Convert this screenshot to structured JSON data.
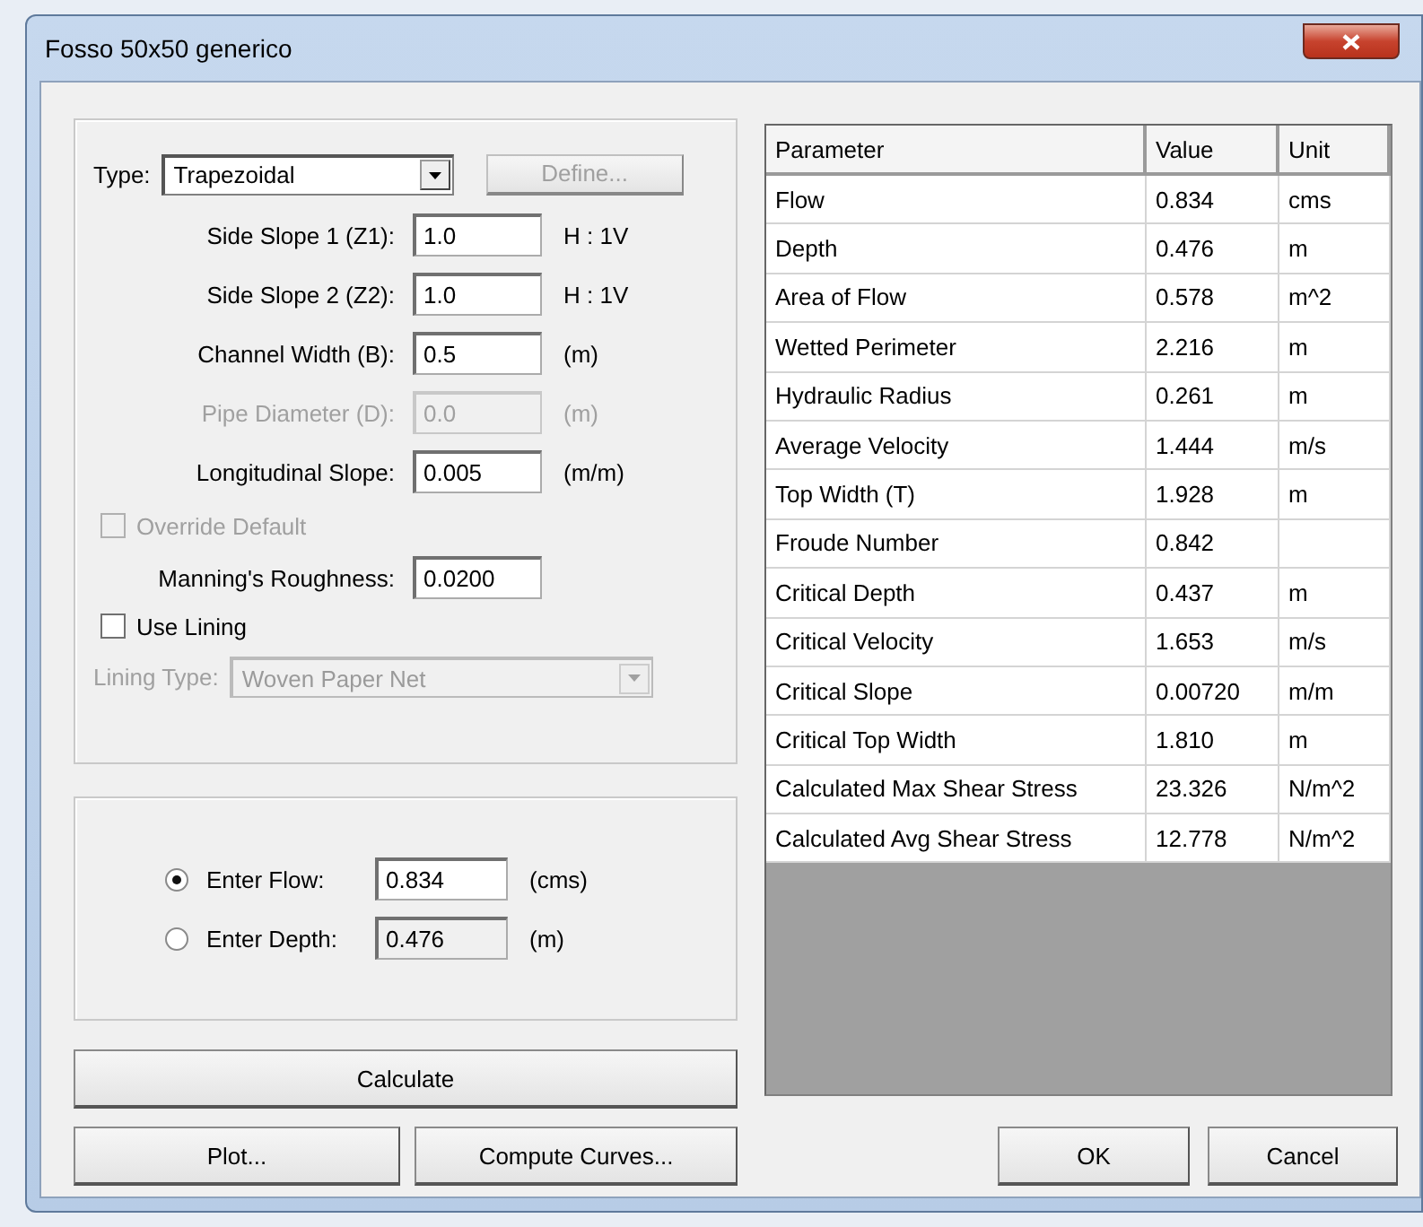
{
  "window": {
    "title": "Fosso 50x50 generico"
  },
  "channel": {
    "type": {
      "label": "Type:",
      "value": "Trapezoidal"
    },
    "define_button": {
      "label": "Define...",
      "disabled": true
    },
    "fields": [
      {
        "label": "Side Slope 1 (Z1):",
        "value": "1.0",
        "unit": "H : 1V",
        "disabled": false
      },
      {
        "label": "Side Slope 2 (Z2):",
        "value": "1.0",
        "unit": "H : 1V",
        "disabled": false
      },
      {
        "label": "Channel Width (B):",
        "value": "0.5",
        "unit": "(m)",
        "disabled": false
      },
      {
        "label": "Pipe Diameter (D):",
        "value": "0.0",
        "unit": "(m)",
        "disabled": true
      },
      {
        "label": "Longitudinal Slope:",
        "value": "0.005",
        "unit": "(m/m)",
        "disabled": false
      }
    ],
    "override_default": {
      "label": "Override Default",
      "checked": false,
      "disabled": true
    },
    "manning": {
      "label": "Manning's Roughness:",
      "value": "0.0200"
    },
    "use_lining": {
      "label": "Use Lining",
      "checked": false,
      "disabled": false
    },
    "lining_type": {
      "label": "Lining Type:",
      "value": "Woven Paper Net",
      "disabled": true
    }
  },
  "input_mode": [
    {
      "label": "Enter Flow:",
      "value": "0.834",
      "unit": "(cms)",
      "selected": true
    },
    {
      "label": "Enter Depth:",
      "value": "0.476",
      "unit": "(m)",
      "selected": false
    }
  ],
  "buttons": {
    "calculate": "Calculate",
    "plot": "Plot...",
    "compute_curves": "Compute Curves...",
    "ok": "OK",
    "cancel": "Cancel"
  },
  "results": {
    "columns": [
      "Parameter",
      "Value",
      "Unit"
    ],
    "rows": [
      [
        "Flow",
        "0.834",
        "cms"
      ],
      [
        "Depth",
        "0.476",
        "m"
      ],
      [
        "Area of Flow",
        "0.578",
        "m^2"
      ],
      [
        "Wetted Perimeter",
        "2.216",
        "m"
      ],
      [
        "Hydraulic Radius",
        "0.261",
        "m"
      ],
      [
        "Average Velocity",
        "1.444",
        "m/s"
      ],
      [
        "Top Width (T)",
        "1.928",
        "m"
      ],
      [
        "Froude Number",
        "0.842",
        ""
      ],
      [
        "Critical Depth",
        "0.437",
        "m"
      ],
      [
        "Critical Velocity",
        "1.653",
        "m/s"
      ],
      [
        "Critical Slope",
        "0.00720",
        "m/m"
      ],
      [
        "Critical Top Width",
        "1.810",
        "m"
      ],
      [
        "Calculated Max Shear Stress",
        "23.326",
        "N/m^2"
      ],
      [
        "Calculated Avg Shear Stress",
        "12.778",
        "N/m^2"
      ]
    ]
  }
}
